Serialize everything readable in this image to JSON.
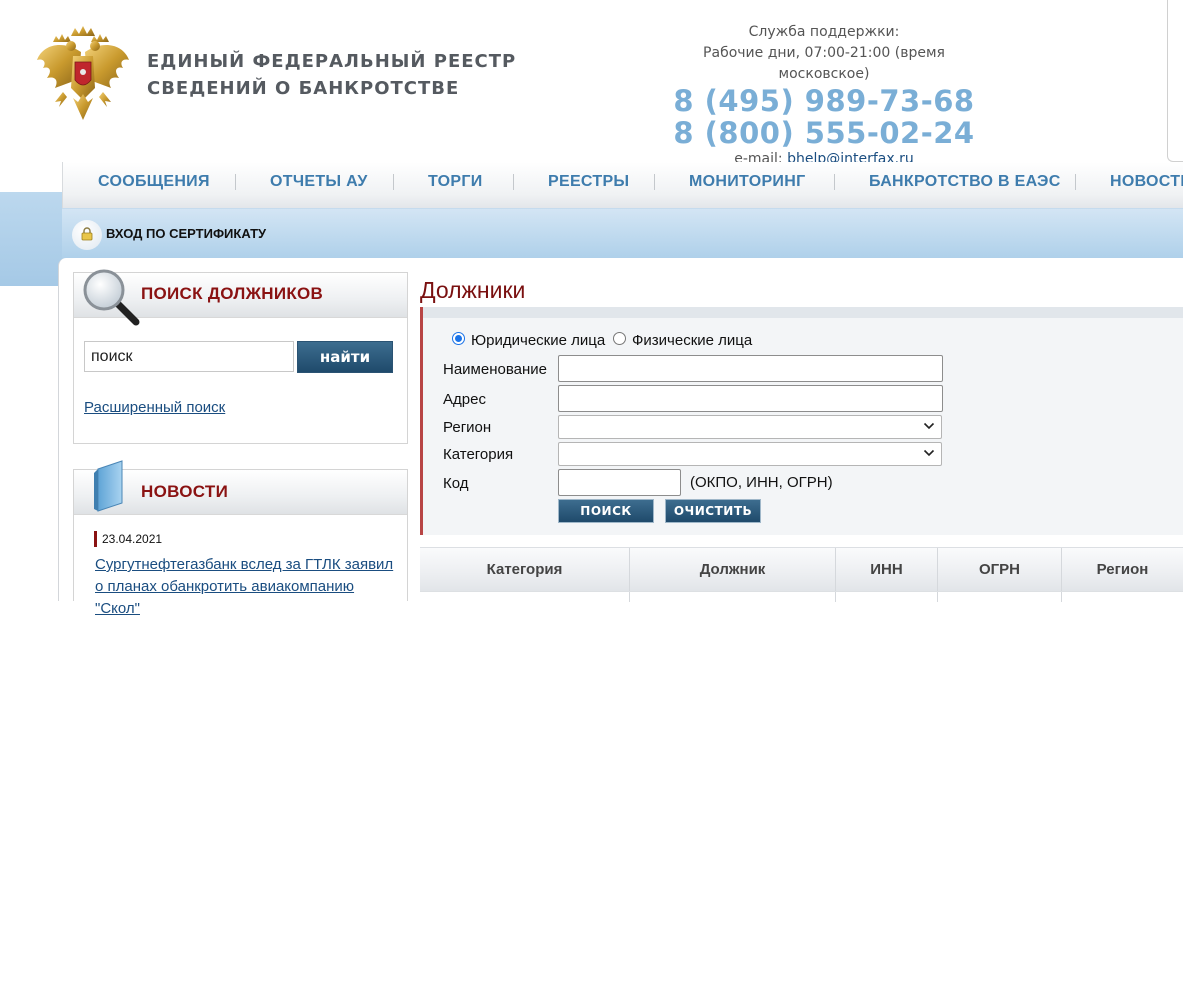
{
  "header": {
    "title_line1": "ЕДИНЫЙ ФЕДЕРАЛЬНЫЙ РЕЕСТР",
    "title_line2": "СВЕДЕНИЙ О БАНКРОТСТВЕ",
    "support_label": "Служба поддержки:",
    "work_hours": "Рабочие дни, 07:00-21:00 (время московское)",
    "phone1": "8 (495) 989-73-68",
    "phone2": "8 (800) 555-02-24",
    "email_label": "e-mail:",
    "email": "bhelp@interfax.ru"
  },
  "nav": {
    "items": [
      "СООБЩЕНИЯ",
      "ОТЧЕТЫ АУ",
      "ТОРГИ",
      "РЕЕСТРЫ",
      "МОНИТОРИНГ",
      "БАНКРОТСТВО В ЕАЭС",
      "НОВОСТИ"
    ]
  },
  "cert": {
    "label": "ВХОД ПО СЕРТИФИКАТУ",
    "icon": "lock-icon"
  },
  "sidebar": {
    "search": {
      "title": "ПОИСК ДОЛЖНИКОВ",
      "input_value": "поиск",
      "button": "найти",
      "advanced_link": "Расширенный поиск",
      "icon": "magnifier-icon"
    },
    "news": {
      "title": "НОВОСТИ",
      "icon": "book-icon",
      "items": [
        {
          "date": "23.04.2021",
          "text": "Сургутнефтегазбанк вслед за ГТЛК заявил о планах обанкротить авиакомпанию \"Скол\""
        }
      ]
    }
  },
  "main": {
    "title": "Должники",
    "radio_legal": "Юридические лица",
    "radio_individual": "Физические лица",
    "radio_selected": "legal",
    "fields": {
      "name_label": "Наименование",
      "address_label": "Адрес",
      "region_label": "Регион",
      "category_label": "Категория",
      "code_label": "Код",
      "code_hint": "(ОКПО, ИНН, ОГРН)"
    },
    "buttons": {
      "search": "ПОИСК",
      "clear": "ОЧИСТИТЬ"
    },
    "table": {
      "columns": [
        "Категория",
        "Должник",
        "ИНН",
        "ОГРН",
        "Регион"
      ]
    }
  },
  "colors": {
    "accent_blue": "#3e7cad",
    "phone_blue": "#7aaed6",
    "title_red": "#8a1212",
    "button_dark": "#1f4a6b"
  }
}
